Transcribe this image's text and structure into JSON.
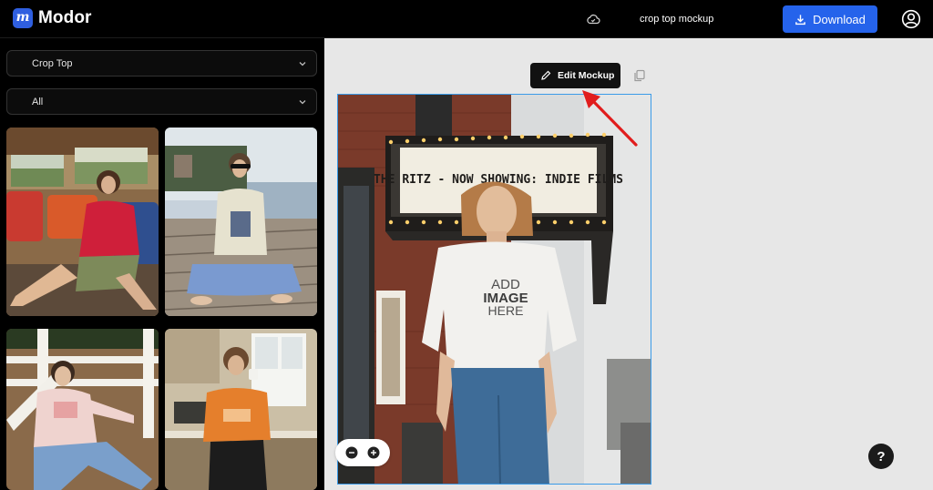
{
  "header": {
    "logo_letter": "m",
    "app_name": "Modor",
    "doc_title": "crop top mockup",
    "download_label": "Download"
  },
  "sidebar": {
    "category_select": {
      "value": "Crop Top"
    },
    "filter_select": {
      "value": "All"
    },
    "thumbnails": [
      {
        "icon": "photo-woman-bus-red-crop-top"
      },
      {
        "icon": "photo-woman-dock-sweater"
      },
      {
        "icon": "photo-woman-fence-pink-sweater"
      },
      {
        "icon": "photo-woman-kitchen-orange-top"
      }
    ]
  },
  "canvas": {
    "edit_button_label": "Edit Mockup",
    "marquee_text": "THE RITZ - NOW SHOWING: INDIE FILMS",
    "placeholder_line1": "ADD",
    "placeholder_line2": "IMAGE",
    "placeholder_line3": "HERE",
    "help_label": "?"
  },
  "colors": {
    "accent": "#2563eb",
    "logo_bg": "#2f5fe0",
    "selection_border": "#3b9be8",
    "annotation_arrow": "#e11d1d",
    "canvas_bg": "#e7e7e7"
  }
}
